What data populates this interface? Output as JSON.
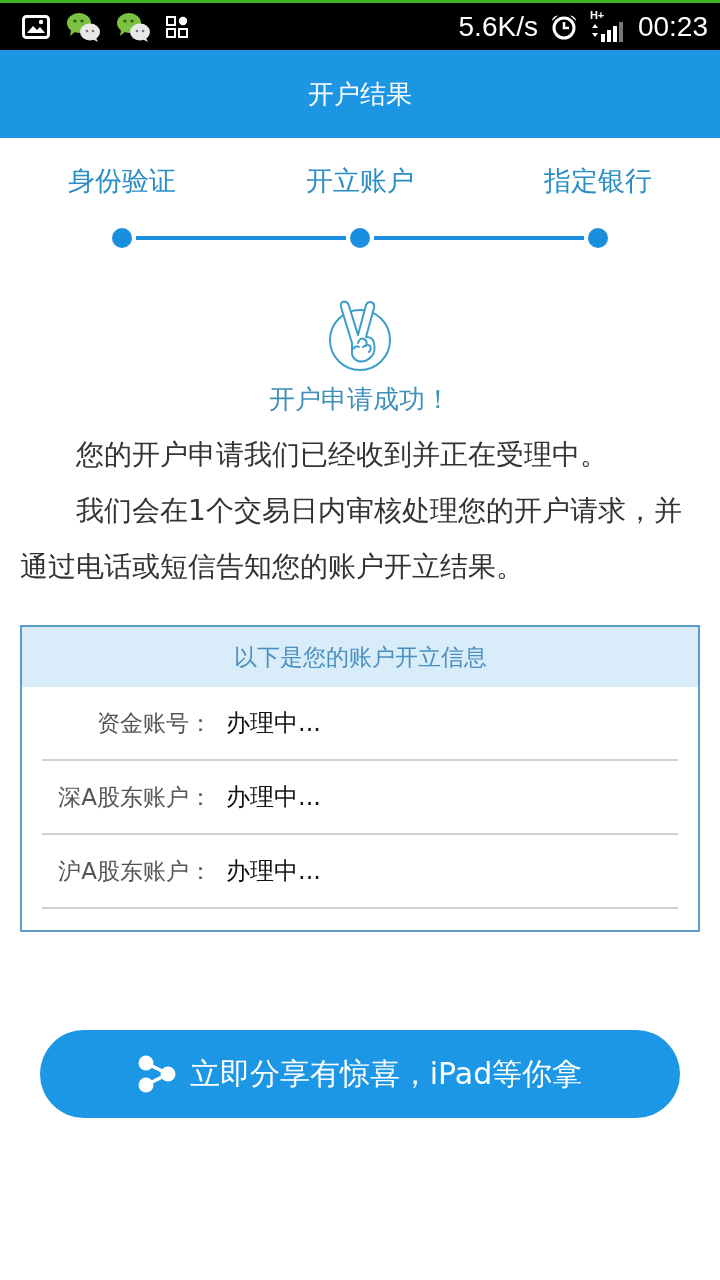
{
  "status_bar": {
    "network_speed": "5.6K/s",
    "network_type": "H+",
    "time": "00:23"
  },
  "header": {
    "title": "开户结果"
  },
  "steps": [
    {
      "label": "身份验证"
    },
    {
      "label": "开立账户"
    },
    {
      "label": "指定银行"
    }
  ],
  "result": {
    "message": "开户申请成功！"
  },
  "paragraphs": [
    "您的开户申请我们已经收到并正在受理中。",
    "我们会在1个交易日内审核处理您的开户请求，并通过电话或短信告知您的账户开立结果。"
  ],
  "account_info": {
    "title": "以下是您的账户开立信息",
    "rows": [
      {
        "label": "资金账号：",
        "value": "办理中..."
      },
      {
        "label": "深A股东账户：",
        "value": "办理中..."
      },
      {
        "label": "沪A股东账户：",
        "value": "办理中..."
      }
    ]
  },
  "share_button": {
    "label": "立即分享有惊喜，iPad等你拿"
  }
}
